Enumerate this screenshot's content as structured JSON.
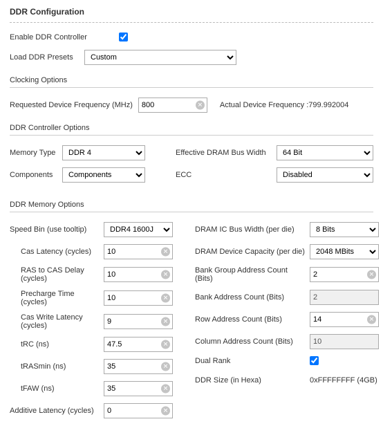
{
  "title": "DDR Configuration",
  "enable": {
    "label": "Enable DDR Controller",
    "checked": true
  },
  "presets": {
    "label": "Load DDR Presets",
    "value": "Custom"
  },
  "sections": {
    "clocking": "Clocking Options",
    "controller": "DDR Controller Options",
    "memory": "DDR Memory Options"
  },
  "clocking": {
    "req_label": "Requested Device Frequency (MHz)",
    "req_value": "800",
    "actual_label": "Actual Device Frequency :",
    "actual_value": "799.992004"
  },
  "controller": {
    "mem_type_label": "Memory Type",
    "mem_type_value": "DDR 4",
    "components_label": "Components",
    "components_value": "Components",
    "bus_width_label": "Effective DRAM Bus Width",
    "bus_width_value": "64 Bit",
    "ecc_label": "ECC",
    "ecc_value": "Disabled"
  },
  "mem_left": {
    "speed_bin_label": "Speed Bin (use tooltip)",
    "speed_bin_value": "DDR4 1600J",
    "cas_latency_label": "Cas Latency (cycles)",
    "cas_latency_value": "10",
    "ras_cas_label": "RAS to CAS Delay (cycles)",
    "ras_cas_value": "10",
    "precharge_label": "Precharge Time (cycles)",
    "precharge_value": "10",
    "cas_write_label": "Cas Write Latency (cycles)",
    "cas_write_value": "9",
    "trc_label": "tRC (ns)",
    "trc_value": "47.5",
    "trasmin_label": "tRASmin (ns)",
    "trasmin_value": "35",
    "tfaw_label": "tFAW (ns)",
    "tfaw_value": "35",
    "additive_label": "Additive Latency (cycles)",
    "additive_value": "0"
  },
  "mem_right": {
    "ic_bus_label": "DRAM IC Bus Width (per die)",
    "ic_bus_value": "8 Bits",
    "capacity_label": "DRAM Device Capacity (per die)",
    "capacity_value": "2048 MBits",
    "bank_group_label": "Bank Group Address Count (Bits)",
    "bank_group_value": "2",
    "bank_addr_label": "Bank Address Count (Bits)",
    "bank_addr_value": "2",
    "row_addr_label": "Row Address Count (Bits)",
    "row_addr_value": "14",
    "col_addr_label": "Column Address Count (Bits)",
    "col_addr_value": "10",
    "dual_rank_label": "Dual Rank",
    "dual_rank_checked": true,
    "ddr_size_label": "DDR Size (in Hexa)",
    "ddr_size_value": "0xFFFFFFFF (4GB)"
  }
}
